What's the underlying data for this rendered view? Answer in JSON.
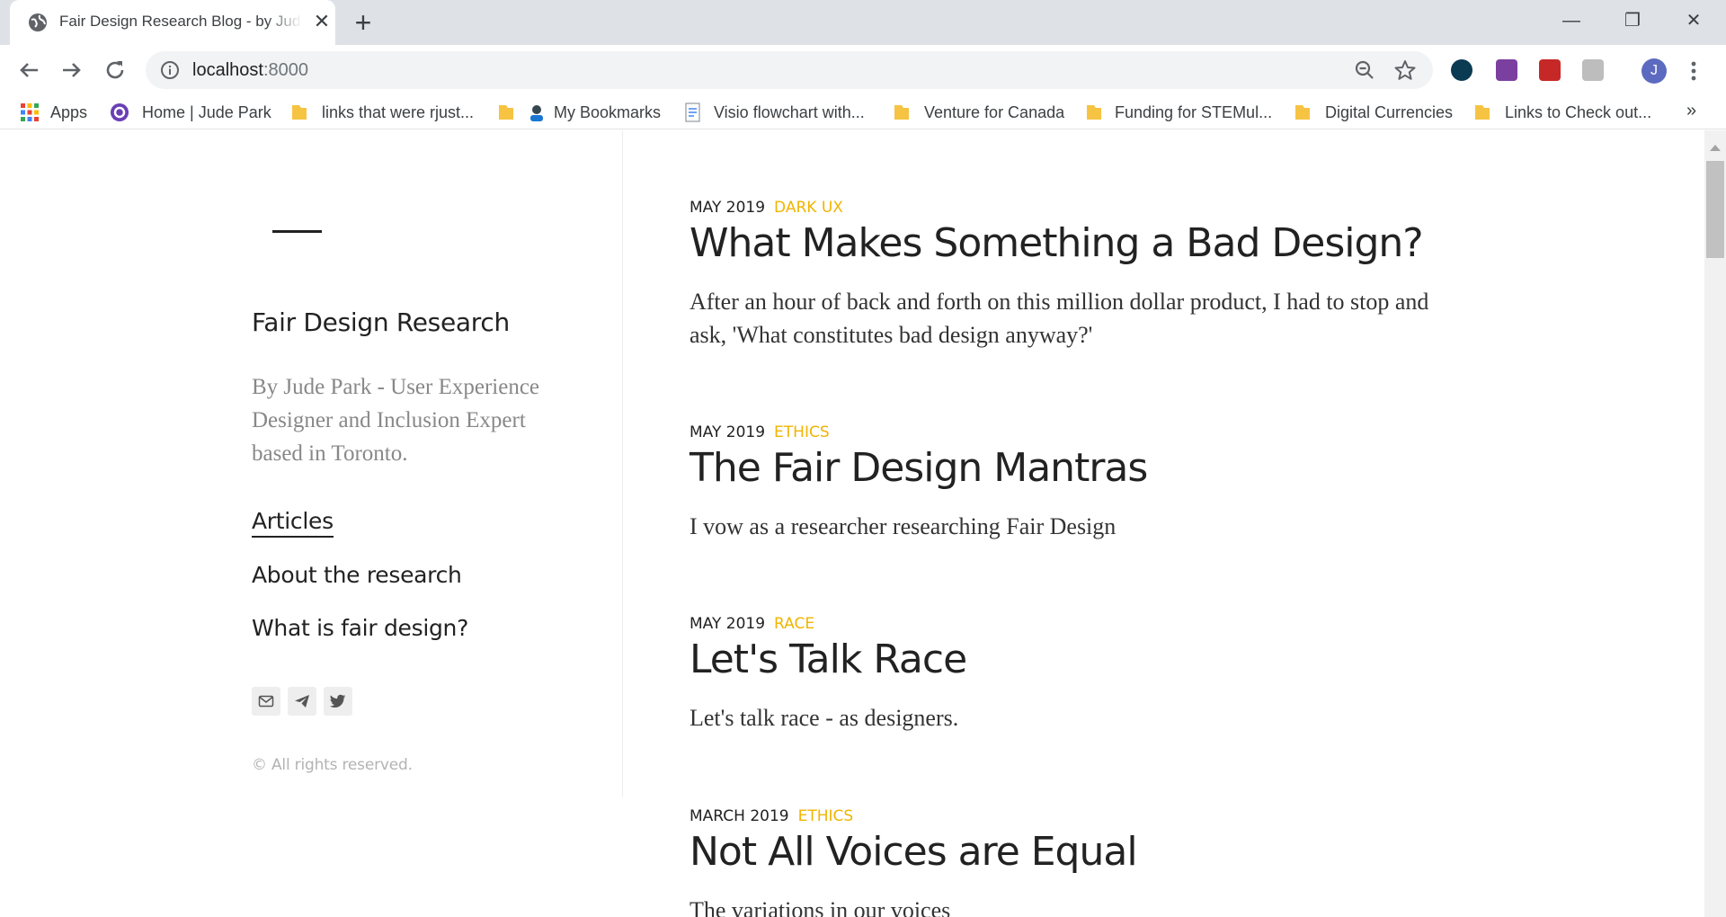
{
  "browser": {
    "tab_title": "Fair Design Research Blog - by Jude Park",
    "tab_close": "✕",
    "new_tab": "+",
    "window_controls": {
      "minimize": "—",
      "restore": "❐",
      "close": "✕"
    },
    "url_host": "localhost",
    "url_port": ":8000",
    "profile_initial": "J",
    "extensions": [
      {
        "name": "extension-dark-icon",
        "color": "#0b3a53"
      },
      {
        "name": "extension-nx-icon",
        "color": "#7b3fa0"
      },
      {
        "name": "extension-red-icon",
        "color": "#c62828"
      },
      {
        "name": "extension-gray-icon",
        "color": "#9e9e9e"
      }
    ],
    "bookmarks": [
      {
        "label": "Apps",
        "icon": "apps-grid-icon"
      },
      {
        "label": "Home | Jude Park",
        "icon": "site-icon"
      },
      {
        "label": "links that were rjust...",
        "icon": "folder-icon"
      },
      {
        "label": "My Bookmarks",
        "icon": "folder-icon"
      },
      {
        "label": "Visio flowchart with...",
        "icon": "document-icon"
      },
      {
        "label": "Venture for Canada",
        "icon": "folder-icon"
      },
      {
        "label": "Funding for STEMul...",
        "icon": "folder-icon"
      },
      {
        "label": "Digital Currencies",
        "icon": "folder-icon"
      },
      {
        "label": "Links to Check out...",
        "icon": "folder-icon"
      }
    ],
    "bookmarks_overflow": "»"
  },
  "sidebar": {
    "title": "Fair Design Research",
    "description": "By Jude Park - User Experience Designer and Inclusion Expert based in Toronto.",
    "nav": [
      {
        "label": "Articles",
        "active": true
      },
      {
        "label": "About the research",
        "active": false
      },
      {
        "label": "What is fair design?",
        "active": false
      }
    ],
    "social": [
      "mail-icon",
      "telegram-icon",
      "twitter-icon"
    ],
    "copyright": "© All rights reserved."
  },
  "posts": [
    {
      "date": "MAY 2019",
      "tag": "DARK UX",
      "title": "What Makes Something a Bad Design?",
      "excerpt": "After an hour of back and forth on this million dollar product, I had to stop and ask, 'What constitutes bad design anyway?'"
    },
    {
      "date": "MAY 2019",
      "tag": "ETHICS",
      "title": "The Fair Design Mantras",
      "excerpt": "I vow as a researcher researching Fair Design"
    },
    {
      "date": "MAY 2019",
      "tag": "RACE",
      "title": "Let's Talk Race",
      "excerpt": "Let's talk race - as designers."
    },
    {
      "date": "MARCH 2019",
      "tag": "ETHICS",
      "title": "Not All Voices are Equal",
      "excerpt": "The variations in our voices"
    }
  ],
  "colors": {
    "tag_accent": "#f0b400",
    "chrome_bg": "#dee1e6",
    "omnibox_bg": "#f1f3f4"
  }
}
